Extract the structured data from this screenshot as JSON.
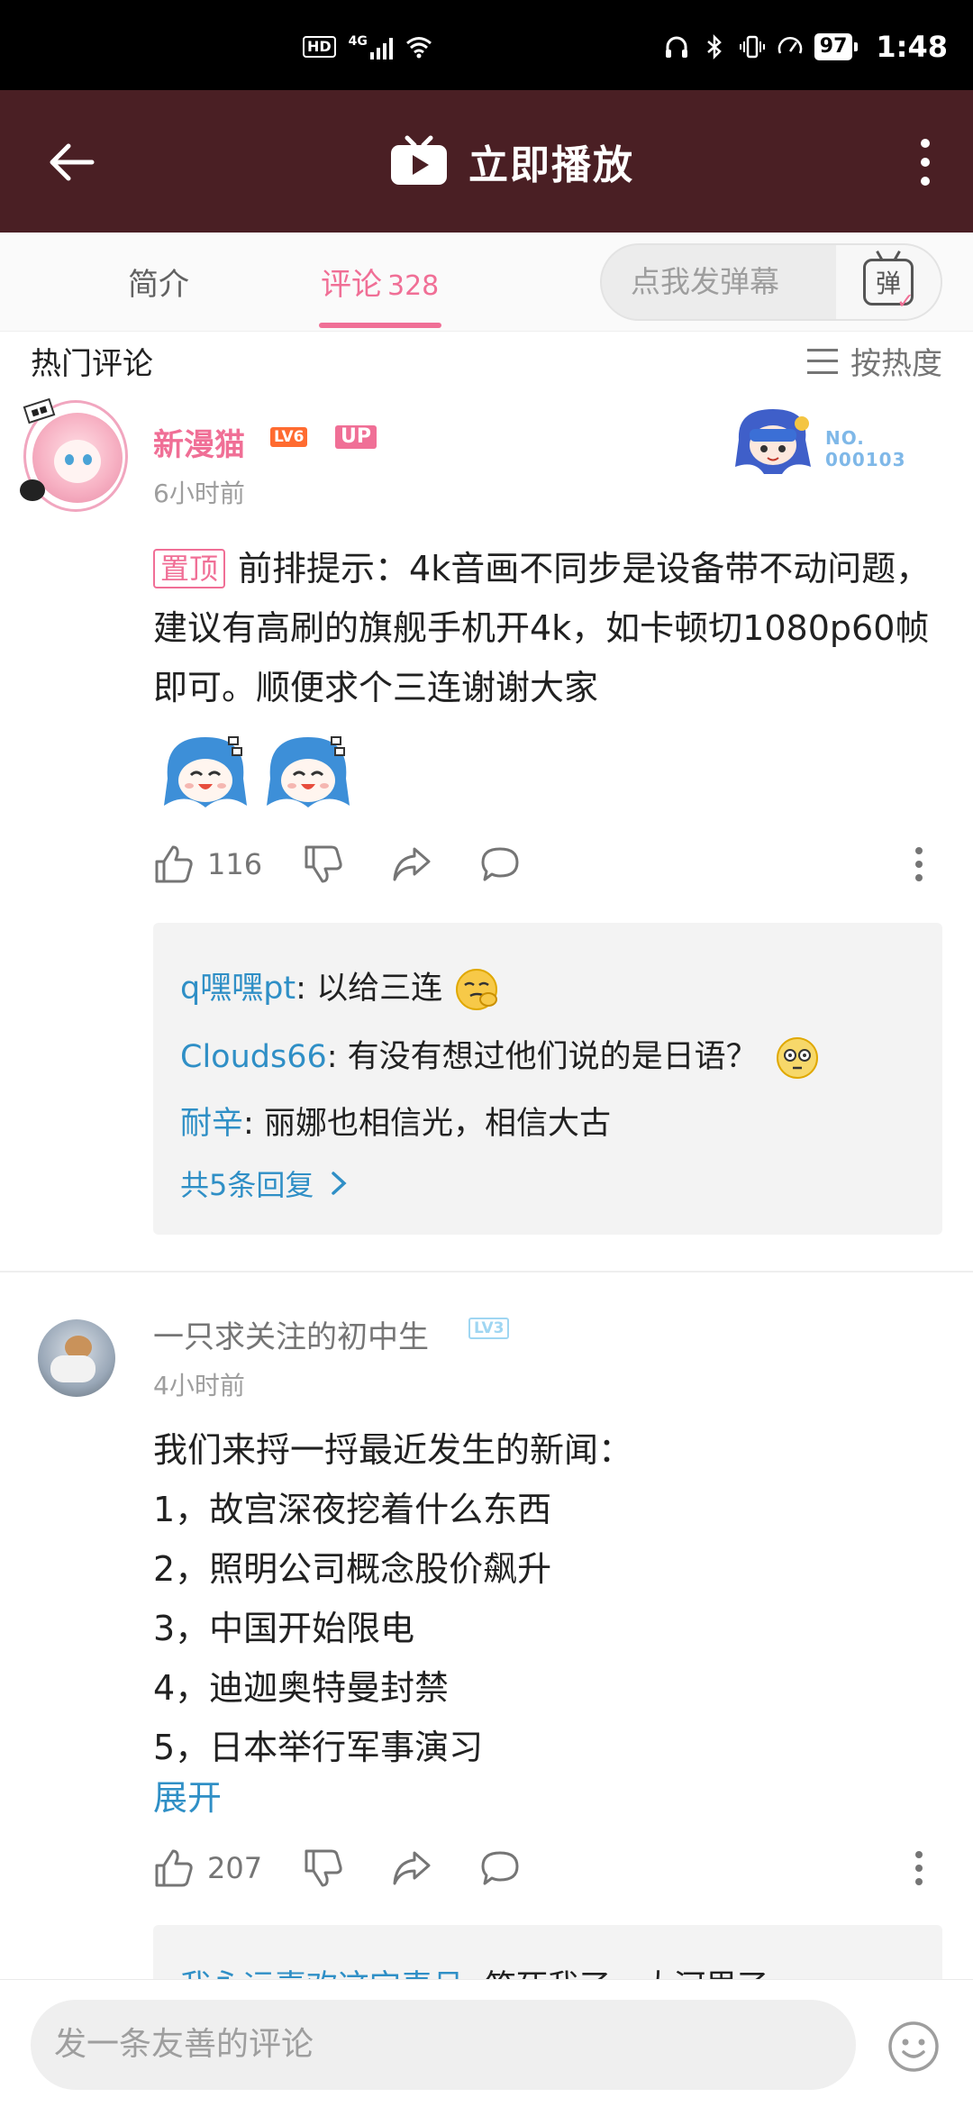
{
  "status_bar": {
    "hd": "HD",
    "network": "4G",
    "battery": "97",
    "time": "1:48"
  },
  "header": {
    "title": "立即播放",
    "back_icon": "arrow-left-icon",
    "more_icon": "more-vertical-icon"
  },
  "tabs": {
    "intro": "简介",
    "comments_label": "评论",
    "comments_count": "328",
    "active": "comments"
  },
  "danmaku": {
    "placeholder": "点我发弹幕",
    "button_glyph": "弹"
  },
  "section": {
    "title": "热门评论",
    "sort_label": "按热度"
  },
  "comments": [
    {
      "user": "新漫猫",
      "level": "LV6",
      "up_badge": "UP",
      "time": "6小时前",
      "fan_badge": {
        "line1": "NO.",
        "line2": "000103"
      },
      "pin_label": "置顶",
      "text": "前排提示：4k音画不同步是设备带不动问题，建议有高刷的旗舰手机开4k，如卡顿切1080p60帧即可。顺便求个三连谢谢大家",
      "likes": "116",
      "replies": [
        {
          "user": "q嘿嘿pt",
          "text": "以给三连"
        },
        {
          "user": "Clouds66",
          "text": "有没有想过他们说的是日语？"
        },
        {
          "user": "耐辛",
          "text": "丽娜也相信光，相信大古"
        }
      ],
      "reply_more": "共5条回复"
    },
    {
      "user": "一只求关注的初中生",
      "level": "LV3",
      "time": "4小时前",
      "lines": [
        "我们来捋一捋最近发生的新闻：",
        "1，故宫深夜挖着什么东西",
        "2，照明公司概念股价飙升",
        "3，中国开始限电",
        "4，迪迦奥特曼封禁",
        "5，日本举行军事演习"
      ],
      "expand": "展开",
      "likes": "207",
      "reply_peek": {
        "user": "我永远喜欢这宝麦吕",
        "text": "笑死我了，大河里了"
      }
    }
  ],
  "bottom": {
    "placeholder": "发一条友善的评论"
  },
  "colors": {
    "header_bg": "#4a1f24",
    "accent_pink": "#f06f96",
    "link_blue": "#2f8fc6"
  }
}
